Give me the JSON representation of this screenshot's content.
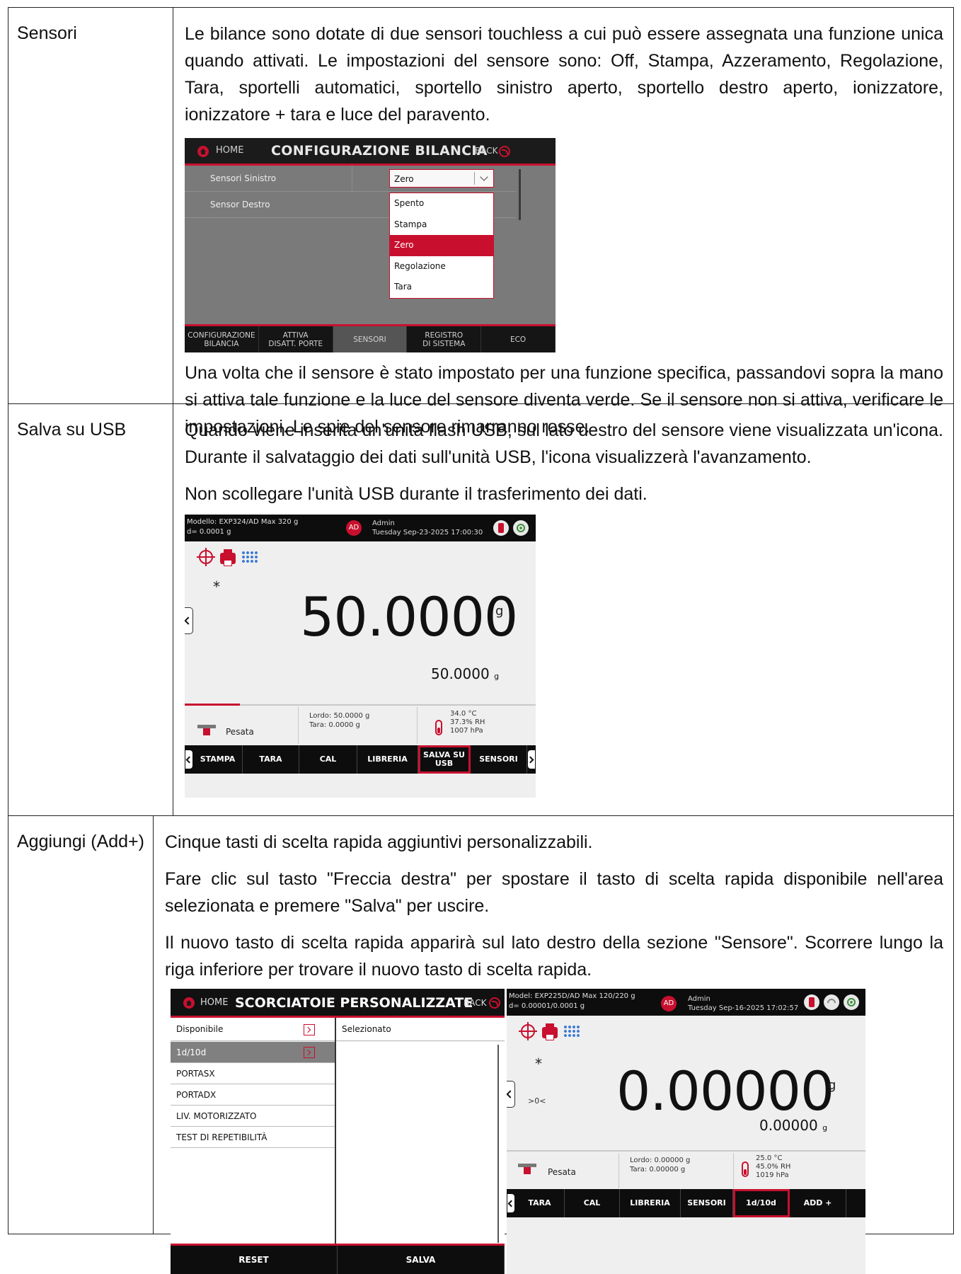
{
  "rows": [
    {
      "label": "Sensori",
      "paragraphs": [
        "Le bilance sono dotate di due sensori touchless a cui può essere assegnata una funzione unica quando attivati. Le impostazioni del sensore sono: Off, Stampa, Azzeramento, Regolazione, Tara, sportelli automatici, sportello sinistro aperto, sportello destro aperto, ionizzatore, ionizzatore + tara e luce del paravento.",
        "Una volta che il sensore è stato impostato per una funzione specifica, passandovi sopra la mano si attiva tale funzione e la luce del sensore diventa verde. Se il sensore non si attiva, verificare le impostazioni. Le spie del sensore rimarranno rosse."
      ]
    },
    {
      "label": "Salva su USB",
      "paragraphs": [
        "Quando viene inserita un'unità flash USB, sul lato destro del sensore viene visualizzata un'icona. Durante il salvataggio dei dati sull'unità USB, l'icona visualizzerà l'avanzamento.",
        "Non scollegare l'unità USB durante il trasferimento dei dati."
      ]
    },
    {
      "label": "Aggiungi (Add+)",
      "paragraphs": [
        "Cinque tasti di scelta rapida aggiuntivi personalizzabili.",
        "Fare clic sul tasto \"Freccia destra\" per spostare il tasto di scelta rapida disponibile nell'area selezionata e premere \"Salva\" per uscire.",
        "Il nuovo tasto di scelta rapida apparirà sul lato destro della sezione \"Sensore\". Scorrere lungo la riga inferiore per trovare il nuovo tasto di scelta rapida."
      ]
    }
  ],
  "config_screen": {
    "home": "HOME",
    "title": "CONFIGURAZIONE BILANCIA",
    "back": "BACK",
    "rows": [
      "Sensori Sinistro",
      "Sensor Destro"
    ],
    "selected_value": "Zero",
    "options": [
      "Spento",
      "Stampa",
      "Zero",
      "Regolazione",
      "Tara"
    ],
    "selected_option": "Zero",
    "tabs": [
      {
        "line1": "CONFIGURAZIONE",
        "line2": "BILANCIA"
      },
      {
        "line1": "ATTIVA",
        "line2": "DISATT. PORTE"
      },
      {
        "line1": "SENSORI",
        "line2": ""
      },
      {
        "line1": "REGISTRO",
        "line2": "DI SISTEMA"
      },
      {
        "line1": "ECO",
        "line2": ""
      }
    ],
    "active_tab": "SENSORI"
  },
  "usb_screen": {
    "model": "Modello: EXP324/AD   Max 320 g",
    "d": "d= 0.0001 g",
    "badge": "AD",
    "user": "Admin",
    "datetime": "Tuesday Sep-23-2025 17:00:30",
    "asterisk": "*",
    "weight": "50.0000",
    "unit": "g",
    "secondary": "50.0000",
    "secondary_unit": "g",
    "mode": "Pesata",
    "gross": "Lordo: 50.0000 g",
    "tare": "Tara: 0.0000 g",
    "temp": "34.0 °C",
    "humidity": "37.3% RH",
    "pressure": "1007 hPa",
    "keys": [
      "STAMPA",
      "TARA",
      "CAL",
      "LIBRERIA",
      "SALVA SU USB",
      "SENSORI"
    ],
    "highlighted_key": "SALVA SU USB"
  },
  "shortcuts_screen": {
    "home": "HOME",
    "title": "SCORCIATOIE PERSONALIZZATE",
    "back": "BACK",
    "available_header": "Disponibile",
    "selected_header": "Selezionato",
    "items": [
      "1d/10d",
      "PORTASX",
      "PORTADX",
      "LIV. MOTORIZZATO",
      "TEST DI REPETIBILITÀ"
    ],
    "selected_item": "1d/10d",
    "reset": "RESET",
    "save": "SALVA"
  },
  "add_screen": {
    "model": "Model: EXP225D/AD   Max 120/220 g",
    "d": "d= 0.00001/0.0001 g",
    "badge": "AD",
    "user": "Admin",
    "datetime": "Tuesday Sep-16-2025 17:02:57",
    "asterisk": "*",
    "zero_indicator": ">0<",
    "weight": "0.00000",
    "unit": "g",
    "secondary": "0.00000",
    "secondary_unit": "g",
    "mode": "Pesata",
    "gross": "Lordo: 0.00000 g",
    "tare": "Tara: 0.00000 g",
    "temp": "25.0 °C",
    "humidity": "45.0% RH",
    "pressure": "1019 hPa",
    "keys": [
      "TARA",
      "CAL",
      "LIBRERIA",
      "SENSORI",
      "1d/10d",
      "ADD +"
    ],
    "highlighted_key": "1d/10d"
  }
}
